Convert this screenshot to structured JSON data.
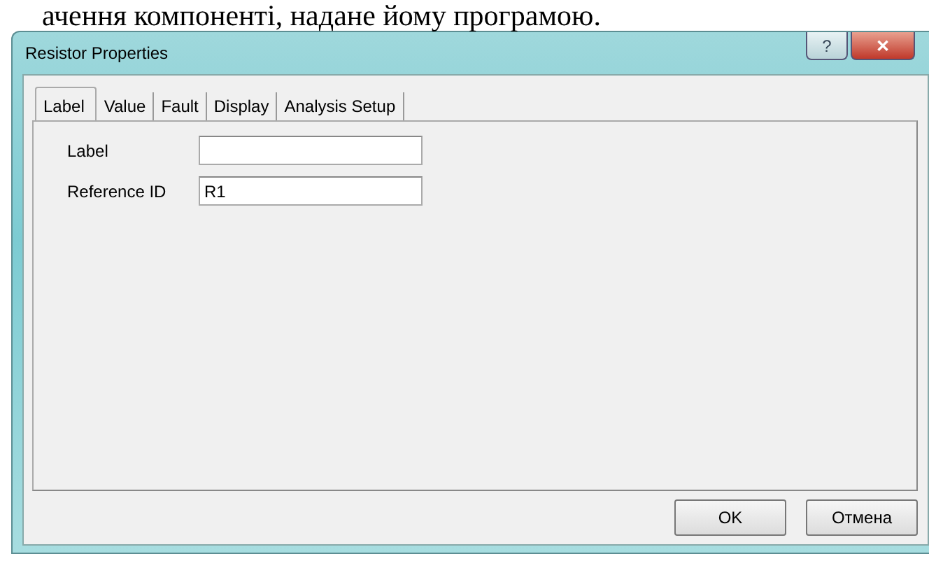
{
  "document_text": "ачення компоненті, надане йому програмою.",
  "window": {
    "title": "Resistor Properties",
    "help_button": "?",
    "close_button": "✕"
  },
  "tabs": [
    {
      "label": "Label",
      "selected": true
    },
    {
      "label": "Value",
      "selected": false
    },
    {
      "label": "Fault",
      "selected": false
    },
    {
      "label": "Display",
      "selected": false
    },
    {
      "label": "Analysis Setup",
      "selected": false
    }
  ],
  "fields": [
    {
      "label": "Label"
    },
    {
      "label": "Reference ID",
      "value": "R1"
    }
  ],
  "buttons": [
    "OK",
    "Отмена"
  ]
}
